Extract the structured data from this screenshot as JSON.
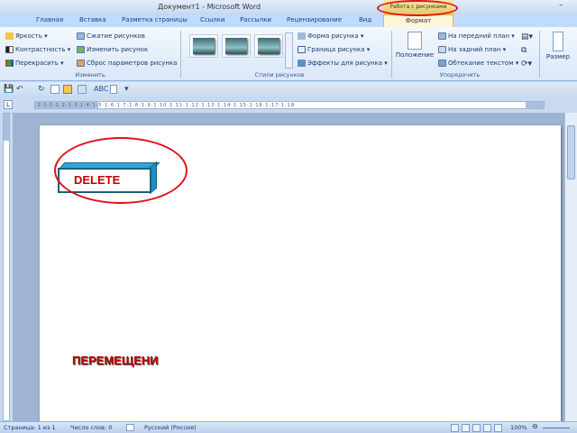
{
  "window": {
    "title": "Документ1 - Microsoft Word",
    "context_tab_group": "Работа с рисунками",
    "minimize_glyph": "–"
  },
  "tabs": [
    {
      "label": "Главная"
    },
    {
      "label": "Вставка"
    },
    {
      "label": "Разметка страницы"
    },
    {
      "label": "Ссылки"
    },
    {
      "label": "Рассылки"
    },
    {
      "label": "Рецензирование"
    },
    {
      "label": "Вид"
    },
    {
      "label": "Формат"
    }
  ],
  "ribbon": {
    "adjust": {
      "group_label": "Изменить",
      "brightness": "Яркость ▾",
      "contrast": "Контрастность ▾",
      "recolor": "Перекрасить ▾",
      "compress": "Сжатие рисунков",
      "change_picture": "Изменить рисунок",
      "reset_picture": "Сброс параметров рисунка"
    },
    "styles": {
      "group_label": "Стили рисунков",
      "shape": "Форма рисунка ▾",
      "border": "Граница рисунка ▾",
      "effects": "Эффекты для рисунка ▾"
    },
    "arrange": {
      "group_label": "Упорядочить",
      "position": "Положение",
      "bring_front": "На передний план ▾",
      "send_back": "На задний план ▾",
      "text_wrap": "Обтекание текстом ▾"
    },
    "size": {
      "label": "Размер"
    }
  },
  "qat": {
    "save": "💾",
    "undo": "↶",
    "redo": "↻",
    "more": "▾"
  },
  "ruler": {
    "ticks": "·2·1·1·1·2·1·3·1·4·1·5·1·6·1·7·1·8·1·9·1·10·1·11·1·12·1·13·1·14·1·15·1·16·1·17·1·18·",
    "tab_selector": "L"
  },
  "document": {
    "delete_label": "DELETE",
    "move_label": "ПЕРЕМЕЩЕНИ"
  },
  "status": {
    "page": "Страница: 1 из 1",
    "words": "Число слов: 0",
    "language": "Русский (Россия)",
    "zoom": "100%"
  },
  "colors": {
    "annotation": "#e0101a",
    "doc_text": "#c00000",
    "box_face": "#2ea8d8"
  }
}
